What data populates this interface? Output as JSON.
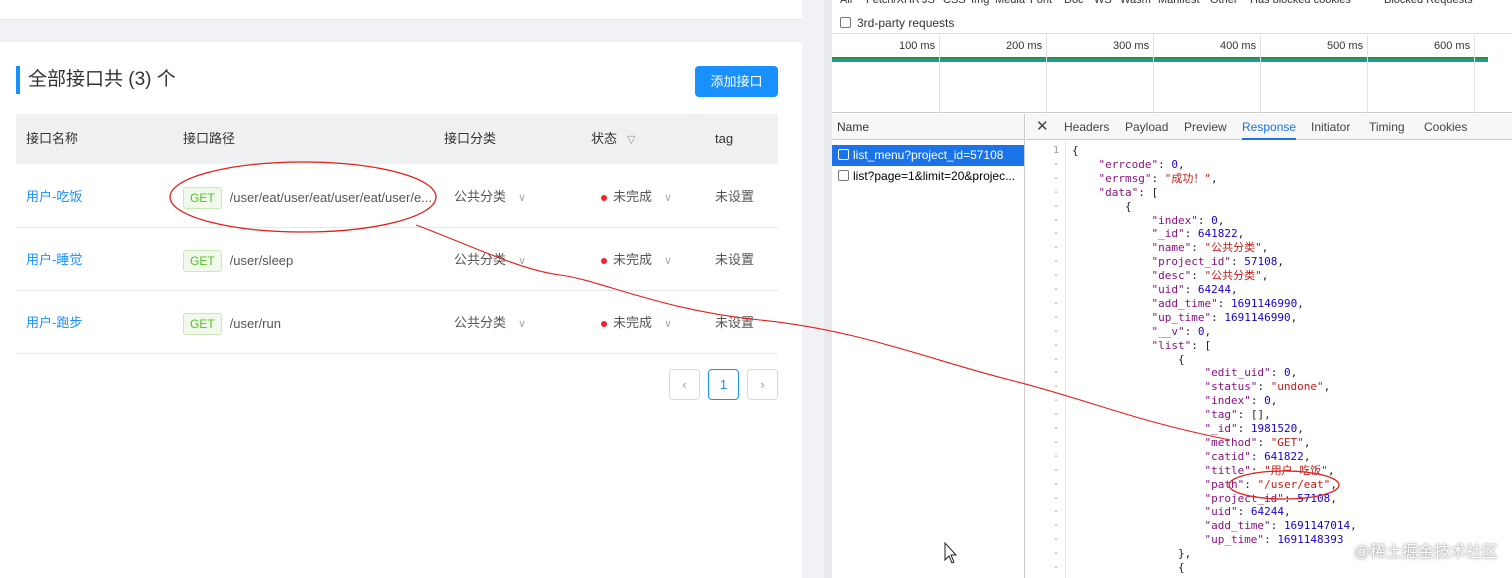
{
  "app": {
    "title": "全部接口共 (3) 个",
    "add_button": "添加接口",
    "columns": {
      "name": "接口名称",
      "path": "接口路径",
      "category": "接口分类",
      "status": "状态",
      "tag": "tag"
    },
    "rows": [
      {
        "name": "用户-吃饭",
        "method": "GET",
        "path": "/user/eat/user/eat/user/eat/user/e...",
        "category": "公共分类",
        "status": "未完成",
        "tag": "未设置"
      },
      {
        "name": "用户-睡觉",
        "method": "GET",
        "path": "/user/sleep",
        "category": "公共分类",
        "status": "未完成",
        "tag": "未设置"
      },
      {
        "name": "用户-跑步",
        "method": "GET",
        "path": "/user/run",
        "category": "公共分类",
        "status": "未完成",
        "tag": "未设置"
      }
    ],
    "pager": {
      "prev": "‹",
      "current": "1",
      "next": "›"
    }
  },
  "devtools": {
    "filter_chips": [
      "All",
      "Fetch/XHR",
      "JS",
      "CSS",
      "Img",
      "Media",
      "Font",
      "Doc",
      "WS",
      "Wasm",
      "Manifest",
      "Other",
      "Has blocked cookies",
      "Blocked Requests"
    ],
    "third_party": "3rd-party requests",
    "timeline_ticks": [
      "100 ms",
      "200 ms",
      "300 ms",
      "400 ms",
      "500 ms",
      "600 ms"
    ],
    "name_header": "Name",
    "requests": [
      "list_menu?project_id=57108",
      "list?page=1&limit=20&projec..."
    ],
    "tabs": [
      "Headers",
      "Payload",
      "Preview",
      "Response",
      "Initiator",
      "Timing",
      "Cookies"
    ],
    "active_tab": "Response",
    "line_numbers": [
      "1",
      "-",
      "-",
      "-",
      "-",
      "-",
      "-",
      "-",
      "-",
      "-",
      "-",
      "-",
      "-",
      "-",
      "-",
      "-",
      "-",
      "-",
      "-",
      "-",
      "-",
      "-",
      "-",
      "-",
      "-",
      "-",
      "-",
      "-",
      "-",
      "-",
      "-"
    ],
    "response_lines": [
      "{",
      "    \"errcode\": 0,",
      "    \"errmsg\": \"成功！\",",
      "    \"data\": [",
      "        {",
      "            \"index\": 0,",
      "            \"_id\": 641822,",
      "            \"name\": \"公共分类\",",
      "            \"project_id\": 57108,",
      "            \"desc\": \"公共分类\",",
      "            \"uid\": 64244,",
      "            \"add_time\": 1691146990,",
      "            \"up_time\": 1691146990,",
      "            \"__v\": 0,",
      "            \"list\": [",
      "                {",
      "                    \"edit_uid\": 0,",
      "                    \"status\": \"undone\",",
      "                    \"index\": 0,",
      "                    \"tag\": [],",
      "                    \"_id\": 1981520,",
      "                    \"method\": \"GET\",",
      "                    \"catid\": 641822,",
      "                    \"title\": \"用户-吃饭\",",
      "                    \"path\": \"/user/eat\",",
      "                    \"project_id\": 57108,",
      "                    \"uid\": 64244,",
      "                    \"add_time\": 1691147014,",
      "                    \"up_time\": 1691148393",
      "                },",
      "                {"
    ],
    "watermark": "@稀土掘金技术社区"
  },
  "colors": {
    "accent": "#1890ff",
    "devtools_blue": "#1a73e8",
    "annotation": "#e0201b"
  }
}
